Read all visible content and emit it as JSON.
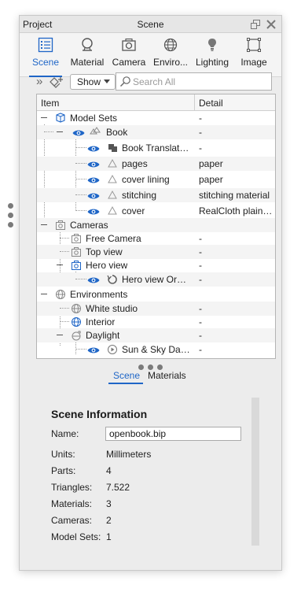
{
  "window": {
    "project_label": "Project",
    "title": "Scene"
  },
  "tabs": [
    {
      "label": "Scene",
      "icon": "scene-list-icon",
      "active": true
    },
    {
      "label": "Material",
      "icon": "material-sphere-icon",
      "active": false
    },
    {
      "label": "Camera",
      "icon": "camera-icon",
      "active": false
    },
    {
      "label": "Enviro...",
      "icon": "globe-icon",
      "active": false
    },
    {
      "label": "Lighting",
      "icon": "bulb-icon",
      "active": false
    },
    {
      "label": "Image",
      "icon": "image-frame-icon",
      "active": false
    }
  ],
  "toolbar": {
    "expand_glyph": "»",
    "show_label": "Show",
    "search_placeholder": "Search All"
  },
  "tree": {
    "col_item": "Item",
    "col_detail": "Detail",
    "rows": [
      {
        "label": "Model Sets",
        "detail": "-"
      },
      {
        "label": "Book",
        "detail": "-"
      },
      {
        "label": "Book Translati...",
        "detail": "-"
      },
      {
        "label": "pages",
        "detail": "paper"
      },
      {
        "label": "cover lining",
        "detail": "paper"
      },
      {
        "label": "stitching",
        "detail": "stitching material"
      },
      {
        "label": "cover",
        "detail": "RealCloth plain ..."
      },
      {
        "label": "Cameras",
        "detail": ""
      },
      {
        "label": "Free Camera",
        "detail": "-"
      },
      {
        "label": "Top view",
        "detail": "-"
      },
      {
        "label": "Hero view",
        "detail": "-"
      },
      {
        "label": "Hero view Orbi...",
        "detail": "-"
      },
      {
        "label": "Environments",
        "detail": ""
      },
      {
        "label": "White studio",
        "detail": "-"
      },
      {
        "label": "Interior",
        "detail": "-"
      },
      {
        "label": "Daylight",
        "detail": "-"
      },
      {
        "label": "Sun & Sky Day...",
        "detail": "-"
      }
    ]
  },
  "subtabs": [
    {
      "label": "Scene",
      "active": true
    },
    {
      "label": "Materials",
      "active": false
    }
  ],
  "info": {
    "title": "Scene Information",
    "name_label": "Name:",
    "name_value": "openbook.bip",
    "units_label": "Units:",
    "units_value": "Millimeters",
    "parts_label": "Parts:",
    "parts_value": "4",
    "triangles_label": "Triangles:",
    "triangles_value": "7.522",
    "materials_label": "Materials:",
    "materials_value": "3",
    "cameras_label": "Cameras:",
    "cameras_value": "2",
    "modelsets_label": "Model Sets:",
    "modelsets_value": "1"
  },
  "colors": {
    "accent": "#1f66c7",
    "eye": "#1f66c7"
  }
}
